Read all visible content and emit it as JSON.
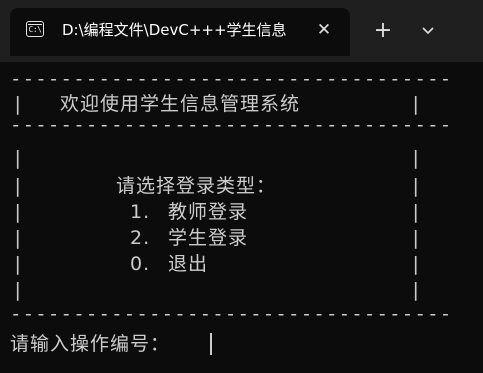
{
  "window": {
    "tab_icon_text": "C:\\",
    "tab_title": "D:\\编程文件\\DevC+++学生信息",
    "tab_close": "✕",
    "new_tab": "+",
    "dropdown_icon": "chevron-down-icon"
  },
  "terminal": {
    "border_dashes": "-----------------------------------",
    "border_pipe": "|",
    "title": "欢迎使用学生信息管理系统",
    "menu_header": "请选择登录类型：",
    "options": [
      {
        "key": "1.",
        "label": "教师登录"
      },
      {
        "key": "2.",
        "label": "学生登录"
      },
      {
        "key": "0.",
        "label": "退出"
      }
    ],
    "prompt": "请输入操作编号："
  },
  "colors": {
    "background": "#0c0c0c",
    "tabstrip": "#1f1f1f",
    "text": "#cccccc"
  }
}
